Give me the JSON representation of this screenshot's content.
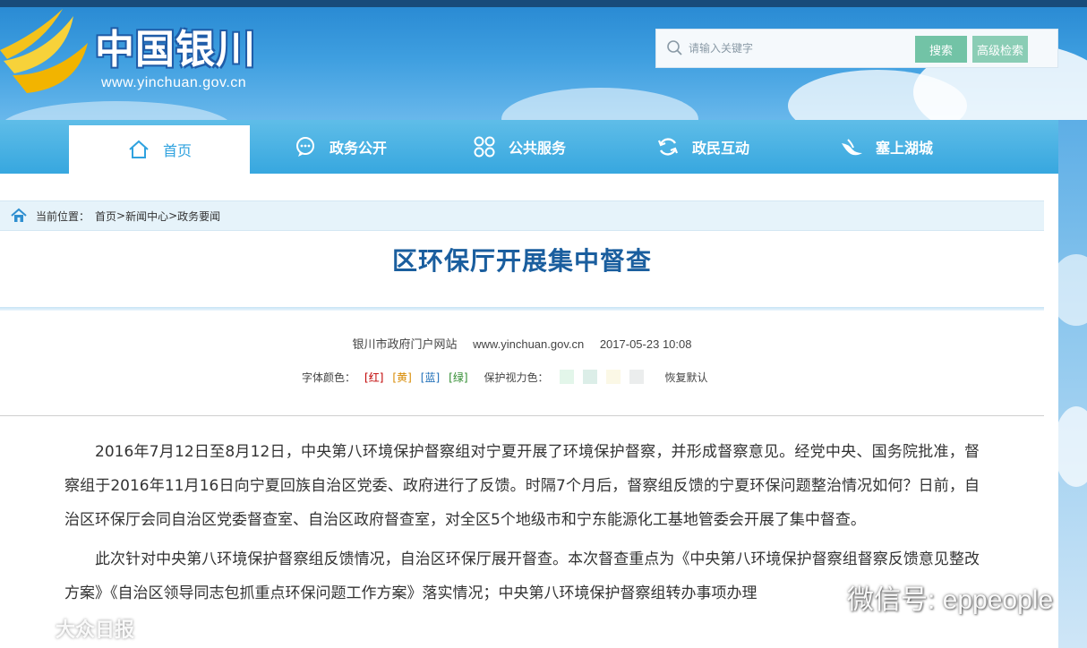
{
  "site": {
    "name": "中国银川",
    "url": "www.yinchuan.gov.cn"
  },
  "search": {
    "placeholder": "请输入关键字",
    "search_label": "搜索",
    "advanced_label": "高级检索"
  },
  "nav": {
    "items": [
      {
        "label": "首页",
        "icon": "home-icon"
      },
      {
        "label": "政务公开",
        "icon": "chat-icon"
      },
      {
        "label": "公共服务",
        "icon": "grid-icon"
      },
      {
        "label": "政民互动",
        "icon": "refresh-icon"
      },
      {
        "label": "塞上湖城",
        "icon": "bird-icon"
      }
    ]
  },
  "breadcrumb": {
    "prefix": "当前位置：",
    "items": [
      "首页",
      ">",
      "新闻中心",
      ">",
      "政务要闻"
    ]
  },
  "article": {
    "title": "区环保厅开展集中督查",
    "source": "银川市政府门户网站",
    "source_url": "www.yinchuan.gov.cn",
    "datetime": "2017-05-23 10:08",
    "font_color_label": "字体颜色：",
    "font_colors": [
      {
        "label": "[红]",
        "color": "#c00000"
      },
      {
        "label": "[黄]",
        "color": "#d88a00"
      },
      {
        "label": "[蓝]",
        "color": "#1f6fb8"
      },
      {
        "label": "[绿]",
        "color": "#2e8b2e"
      }
    ],
    "eye_color_label": "保护视力色：",
    "eye_colors": [
      "#e3f6ea",
      "#dceee8",
      "#fbf8e6",
      "#ebeded"
    ],
    "reset_label": "恢复默认",
    "paragraphs": [
      "2016年7月12日至8月12日，中央第八环境保护督察组对宁夏开展了环境保护督察，并形成督察意见。经党中央、国务院批准，督察组于2016年11月16日向宁夏回族自治区党委、政府进行了反馈。时隔7个月后，督察组反馈的宁夏环保问题整治情况如何？日前，自治区环保厅会同自治区党委督查室、自治区政府督查室，对全区5个地级市和宁东能源化工基地管委会开展了集中督查。",
      "此次针对中央第八环境保护督察组反馈情况，自治区环保厅展开督查。本次督查重点为《中央第八环境保护督察组督察反馈意见整改方案》《自治区领导同志包抓重点环保问题工作方案》落实情况；中央第八环境保护督察组转办事项办理"
    ]
  },
  "watermarks": {
    "wechat": "微信号: eppeople",
    "corner": "大众日报"
  },
  "colors": {
    "nav_bg": "#37a7df",
    "title_color": "#1a5e9e",
    "search_btn": "#72c3a6"
  }
}
